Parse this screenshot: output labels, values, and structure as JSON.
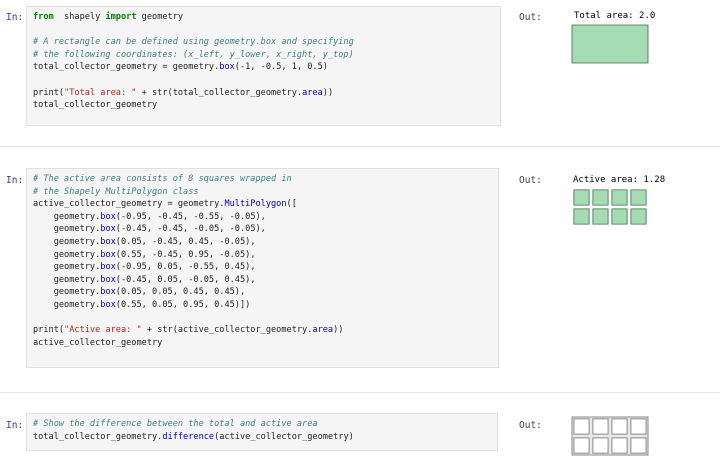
{
  "cells": [
    {
      "prompt": "In:",
      "out_label": "Out:",
      "result_title": "Total area: 2.0",
      "lines": [
        [
          [
            "kw",
            "from"
          ],
          [
            "",
            "  shapely "
          ],
          [
            "kw",
            "import"
          ],
          [
            "",
            " geometry"
          ]
        ],
        [
          [
            "",
            ""
          ]
        ],
        [
          [
            "cm",
            "# A rectangle can be defined using geometry.box and specifying"
          ]
        ],
        [
          [
            "cm",
            "# the following coordinates: (x_left, y_lower, x_right, y_top)"
          ]
        ],
        [
          [
            "",
            "total_collector_geometry = geometry."
          ],
          [
            "at",
            "box"
          ],
          [
            "",
            "(-1, -0.5, 1, 0.5)"
          ]
        ],
        [
          [
            "",
            ""
          ]
        ],
        [
          [
            "",
            "print("
          ],
          [
            "st",
            "\"Total area: \""
          ],
          [
            "",
            " + str(total_collector_geometry."
          ],
          [
            "at",
            "area"
          ],
          [
            "",
            "))"
          ]
        ],
        [
          [
            "",
            "total_collector_geometry"
          ]
        ]
      ],
      "result_shape": {
        "type": "polygon",
        "fill": "#a6dcb4",
        "stroke": "#3d6b4c",
        "boxes": [
          [
            -1,
            -0.5,
            1,
            0.5
          ]
        ]
      }
    },
    {
      "prompt": "In:",
      "out_label": "Out:",
      "result_title": "Active area: 1.28",
      "lines": [
        [
          [
            "cm",
            "# The active area consists of 8 squares wrapped in"
          ]
        ],
        [
          [
            "cm",
            "# the Shapely MultiPolygon class"
          ]
        ],
        [
          [
            "",
            "active_collector_geometry = geometry."
          ],
          [
            "at",
            "MultiPolygon"
          ],
          [
            "",
            "(["
          ]
        ],
        [
          [
            "",
            "    geometry."
          ],
          [
            "at",
            "box"
          ],
          [
            "",
            "(-0.95, -0.45, -0.55, -0.05),"
          ]
        ],
        [
          [
            "",
            "    geometry."
          ],
          [
            "at",
            "box"
          ],
          [
            "",
            "(-0.45, -0.45, -0.05, -0.05),"
          ]
        ],
        [
          [
            "",
            "    geometry."
          ],
          [
            "at",
            "box"
          ],
          [
            "",
            "(0.05, -0.45, 0.45, -0.05),"
          ]
        ],
        [
          [
            "",
            "    geometry."
          ],
          [
            "at",
            "box"
          ],
          [
            "",
            "(0.55, -0.45, 0.95, -0.05),"
          ]
        ],
        [
          [
            "",
            "    geometry."
          ],
          [
            "at",
            "box"
          ],
          [
            "",
            "(-0.95, 0.05, -0.55, 0.45),"
          ]
        ],
        [
          [
            "",
            "    geometry."
          ],
          [
            "at",
            "box"
          ],
          [
            "",
            "(-0.45, 0.05, -0.05, 0.45),"
          ]
        ],
        [
          [
            "",
            "    geometry."
          ],
          [
            "at",
            "box"
          ],
          [
            "",
            "(0.05, 0.05, 0.45, 0.45),"
          ]
        ],
        [
          [
            "",
            "    geometry."
          ],
          [
            "at",
            "box"
          ],
          [
            "",
            "(0.55, 0.05, 0.95, 0.45)])"
          ]
        ],
        [
          [
            "",
            ""
          ]
        ],
        [
          [
            "",
            "print("
          ],
          [
            "st",
            "\"Active area: \""
          ],
          [
            "",
            " + str(active_collector_geometry."
          ],
          [
            "at",
            "area"
          ],
          [
            "",
            "))"
          ]
        ],
        [
          [
            "",
            "active_collector_geometry"
          ]
        ]
      ],
      "result_shape": {
        "type": "multipolygon",
        "fill": "#a6dcb4",
        "stroke": "#3d6b4c",
        "boxes": [
          [
            -0.95,
            -0.45,
            -0.55,
            -0.05
          ],
          [
            -0.45,
            -0.45,
            -0.05,
            -0.05
          ],
          [
            0.05,
            -0.45,
            0.45,
            -0.05
          ],
          [
            0.55,
            -0.45,
            0.95,
            -0.05
          ],
          [
            -0.95,
            0.05,
            -0.55,
            0.45
          ],
          [
            -0.45,
            0.05,
            -0.05,
            0.45
          ],
          [
            0.05,
            0.05,
            0.45,
            0.45
          ],
          [
            0.55,
            0.05,
            0.95,
            0.45
          ]
        ]
      }
    },
    {
      "prompt": "In:",
      "out_label": "Out:",
      "result_title": "",
      "lines": [
        [
          [
            "cm",
            "# Show the difference between the total and active area"
          ]
        ],
        [
          [
            "",
            "total_collector_geometry."
          ],
          [
            "at",
            "difference"
          ],
          [
            "",
            "(active_collector_geometry)"
          ]
        ]
      ],
      "result_shape": {
        "type": "difference",
        "fill": "#e8e8e8",
        "stroke": "#8a8a8a",
        "outer": [
          -1,
          -0.5,
          1,
          0.5
        ],
        "holes": [
          [
            -0.95,
            -0.45,
            -0.55,
            -0.05
          ],
          [
            -0.45,
            -0.45,
            -0.05,
            -0.05
          ],
          [
            0.05,
            -0.45,
            0.45,
            -0.05
          ],
          [
            0.55,
            -0.45,
            0.95,
            -0.05
          ],
          [
            -0.95,
            0.05,
            -0.55,
            0.45
          ],
          [
            -0.45,
            0.05,
            -0.05,
            0.45
          ],
          [
            0.05,
            0.05,
            0.45,
            0.45
          ],
          [
            0.55,
            0.05,
            0.95,
            0.45
          ]
        ]
      }
    }
  ]
}
